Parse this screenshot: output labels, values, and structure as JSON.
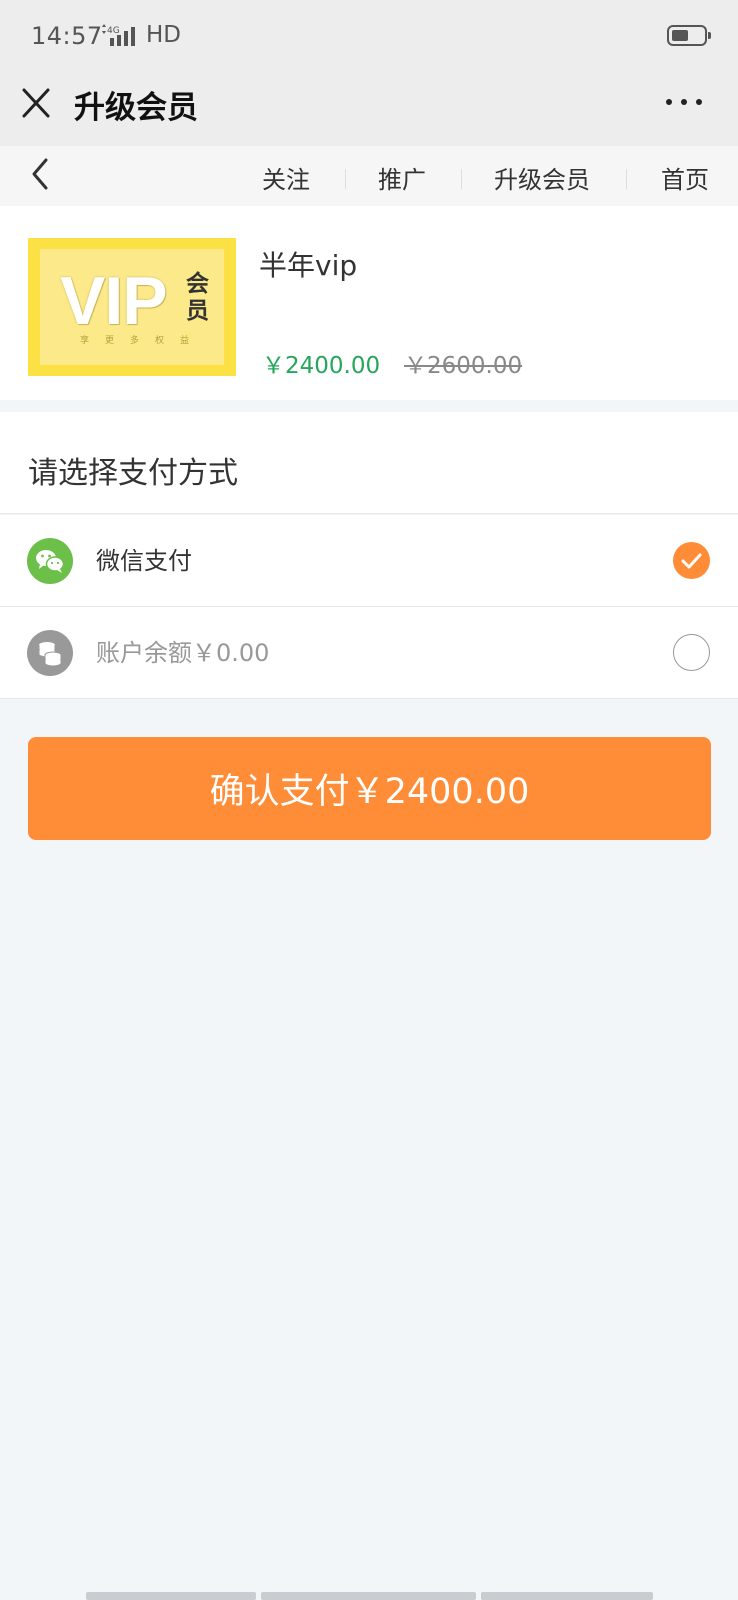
{
  "status_bar": {
    "time": "14:57",
    "network": "4G",
    "hd": "HD"
  },
  "title_bar": {
    "title": "升级会员",
    "close_icon": "close-icon",
    "more_icon": "more-icon"
  },
  "nav": {
    "items": [
      {
        "label": "关注"
      },
      {
        "label": "推广"
      },
      {
        "label": "升级会员"
      },
      {
        "label": "首页"
      }
    ]
  },
  "product": {
    "image": {
      "big_text": "VIP",
      "side_text": "会员",
      "sub_text": "享更多权益"
    },
    "name": "半年vip",
    "price": "￥2400.00",
    "original_price": "￥2600.00"
  },
  "payment": {
    "heading": "请选择支付方式",
    "methods": [
      {
        "label": "微信支付",
        "icon": "wechat-icon",
        "selected": true
      },
      {
        "label": "账户余额￥0.00",
        "icon": "coins-icon",
        "selected": false
      }
    ]
  },
  "confirm_button": {
    "label": "确认支付￥2400.00"
  },
  "colors": {
    "accent": "#ff8c36",
    "price_green": "#26a65b",
    "wechat_green": "#6cc04a"
  }
}
